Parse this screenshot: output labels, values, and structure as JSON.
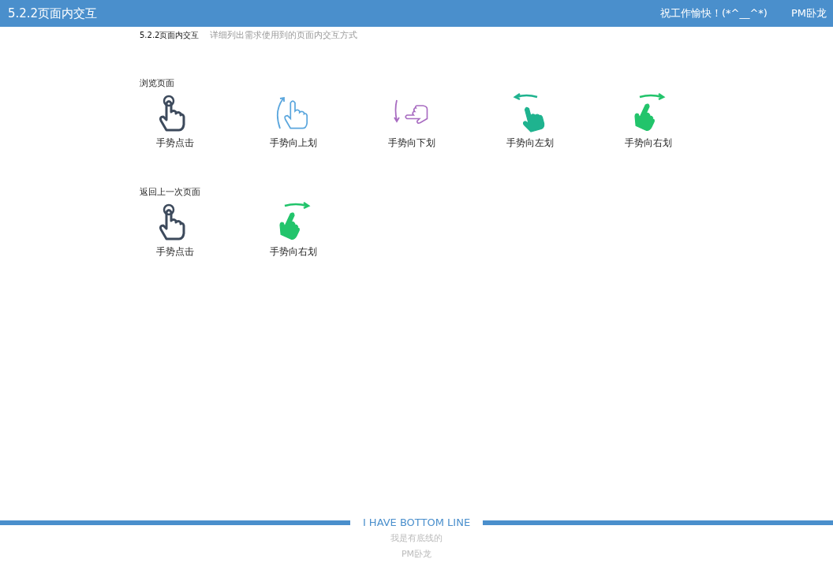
{
  "header": {
    "title": "5.2.2页面内交互",
    "greeting": "祝工作愉快！(*^__^*)",
    "brand": "PM卧龙"
  },
  "subtitle": {
    "title": "5.2.2页面内交互",
    "description": "详细列出需求使用到的页面内交互方式"
  },
  "sections": [
    {
      "title": "浏览页面",
      "gestures": [
        {
          "kind": "tap",
          "label": "手势点击"
        },
        {
          "kind": "swipe-up",
          "label": "手势向上划"
        },
        {
          "kind": "swipe-down",
          "label": "手势向下划"
        },
        {
          "kind": "swipe-left",
          "label": "手势向左划"
        },
        {
          "kind": "swipe-right",
          "label": "手势向右划"
        }
      ]
    },
    {
      "title": "返回上一次页面",
      "gestures": [
        {
          "kind": "tap",
          "label": "手势点击"
        },
        {
          "kind": "swipe-right",
          "label": "手势向右划"
        }
      ]
    }
  ],
  "footer": {
    "slogan": "I HAVE BOTTOM LINE",
    "line_1": "我是有底线的",
    "line_2": "PM卧龙"
  }
}
